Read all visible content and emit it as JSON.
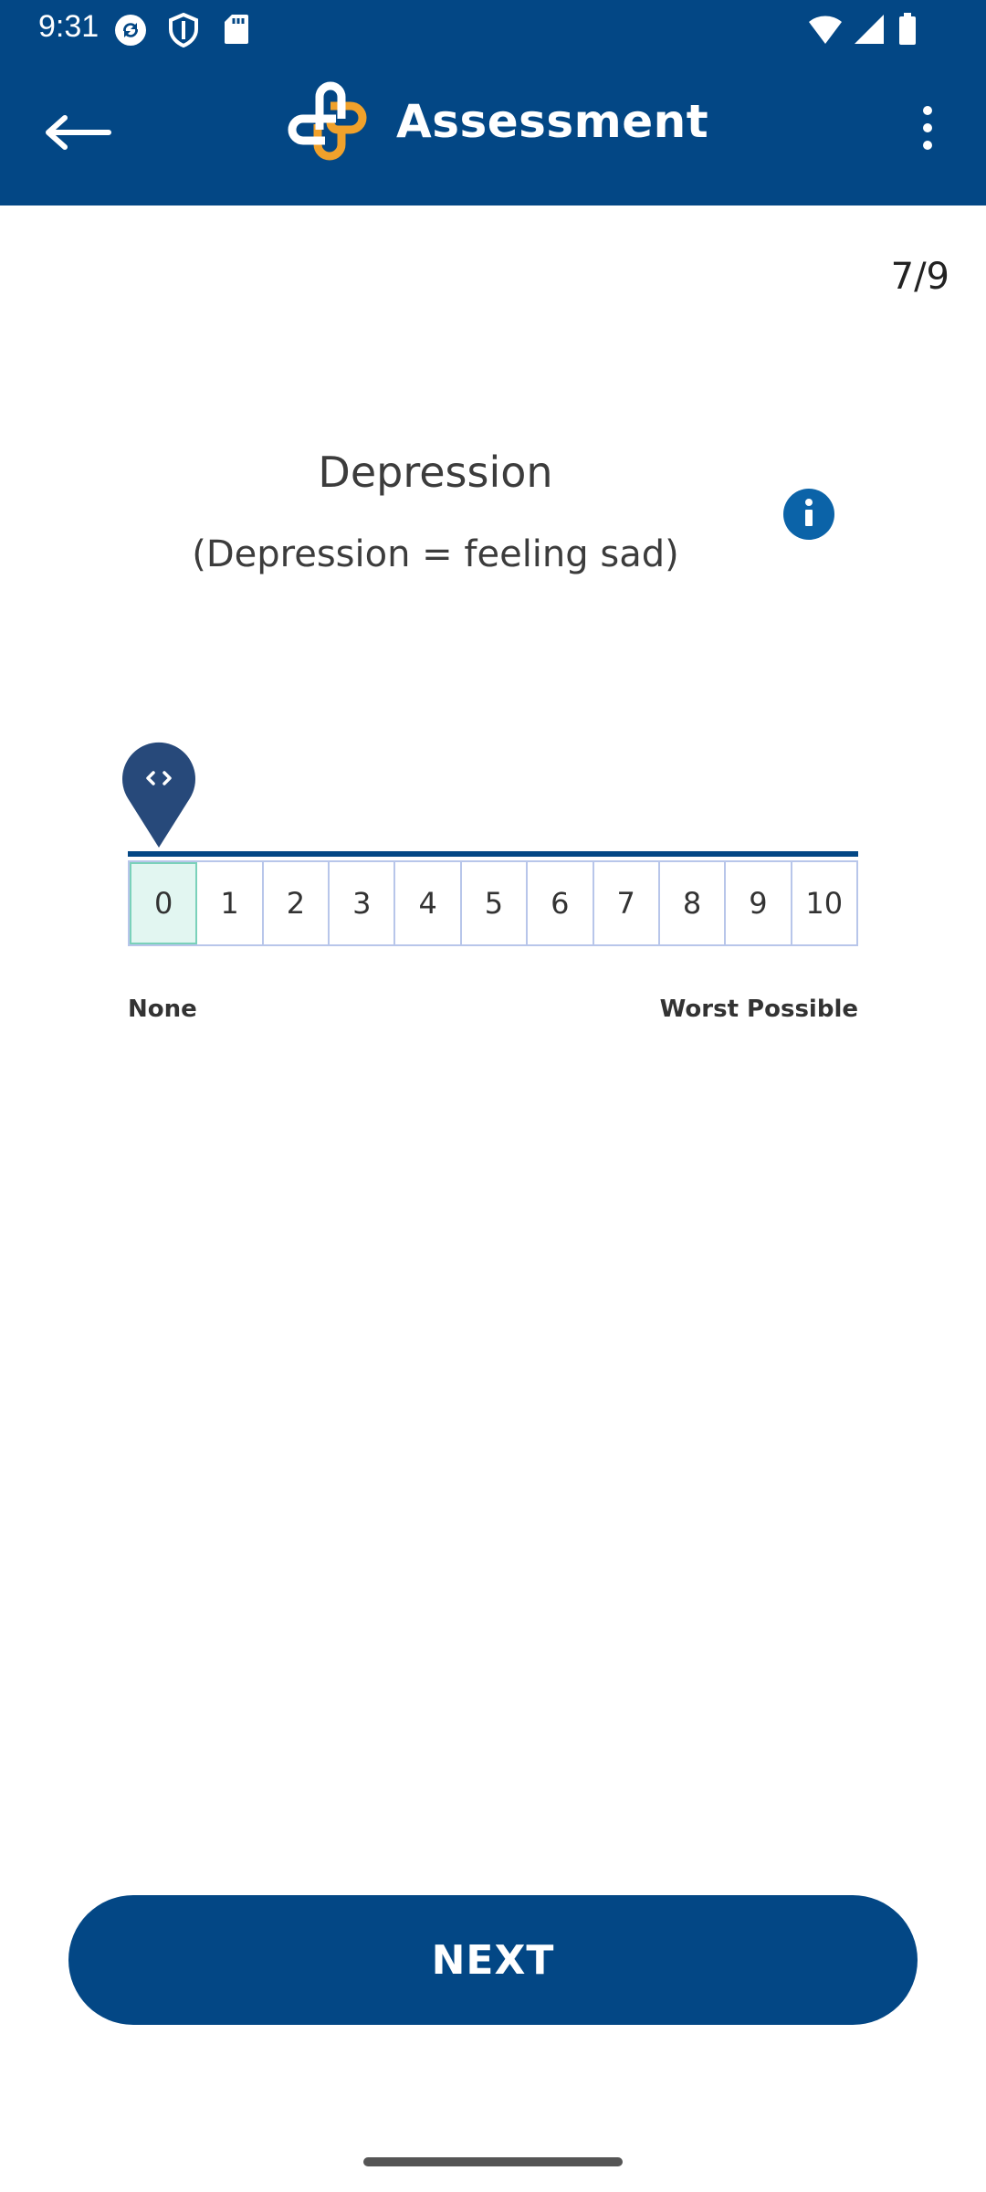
{
  "status_bar": {
    "time": "9:31",
    "icons": [
      "sync-icon",
      "shield-icon",
      "sd-card-icon",
      "wifi-icon",
      "signal-icon",
      "battery-icon"
    ]
  },
  "app_bar": {
    "title": "Assessment",
    "back_icon": "arrow-left-icon",
    "more_icon": "more-vert-icon",
    "colors": {
      "background": "#034785",
      "logo_orange": "#f0a12b"
    }
  },
  "progress": {
    "label": "7/9"
  },
  "question": {
    "title": "Depression",
    "subtitle": "(Depression = feeling sad)",
    "info_icon": "info-icon"
  },
  "scale": {
    "options": [
      "0",
      "1",
      "2",
      "3",
      "4",
      "5",
      "6",
      "7",
      "8",
      "9",
      "10"
    ],
    "selected": "0",
    "min_label": "None",
    "max_label": "Worst Possible"
  },
  "footer": {
    "next_label": "NEXT"
  }
}
